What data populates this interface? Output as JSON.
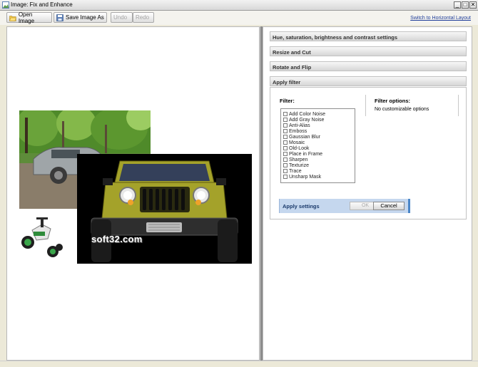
{
  "window": {
    "title": "Image: Fix and Enhance",
    "minimize_label": "_",
    "maximize_label": "□",
    "close_label": "✕"
  },
  "toolbar": {
    "open_label": "Open Image",
    "save_label": "Save Image As",
    "undo_label": "Undo",
    "redo_label": "Redo",
    "switch_layout_link": "Switch to Horizontal Layout"
  },
  "accordion": [
    {
      "label": "Hue, saturation, brightness and contrast settings"
    },
    {
      "label": "Resize and Cut"
    },
    {
      "label": "Rotate and Flip"
    },
    {
      "label": "Apply filter"
    }
  ],
  "filter_panel": {
    "filter_label": "Filter:",
    "options_label": "Filter options:",
    "options_value": "No customizable options",
    "filters": [
      "Add Color Noise",
      "Add Gray Noise",
      "Anti-Alias",
      "Emboss",
      "Gaussian Blur",
      "Mosaic",
      "Old-Look",
      "Place in Frame",
      "Sharpen",
      "Texturize",
      "Trace",
      "Unsharp Mask"
    ],
    "apply_label": "Apply settings",
    "ok_label": "OK",
    "cancel_label": "Cancel"
  },
  "canvas": {
    "watermark": "soft32.com"
  },
  "colors": {
    "accent": "#4a86c8",
    "link": "#1f3d99",
    "jeep_body": "#a4a22a"
  }
}
